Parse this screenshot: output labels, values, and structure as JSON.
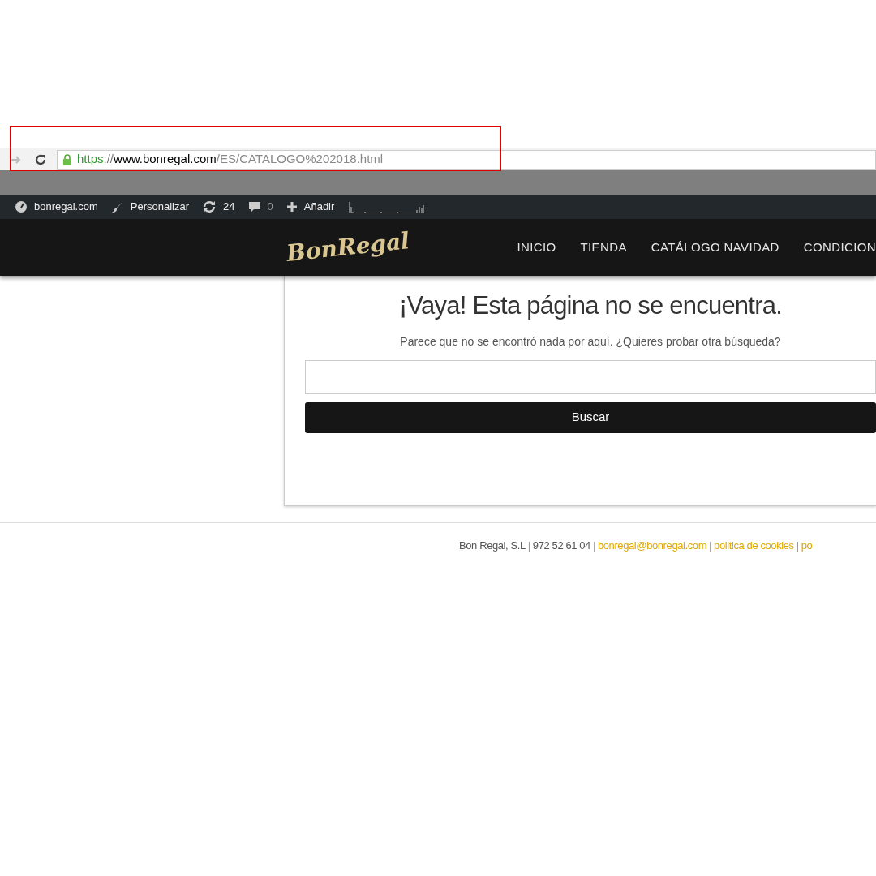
{
  "browser": {
    "url": {
      "scheme": "https",
      "separator": "://",
      "host": "www.bonregal.com",
      "path": "/ES/CATALOGO%202018.html"
    },
    "highlighted": true
  },
  "admin_bar": {
    "items": [
      {
        "kind": "site",
        "label": "bonregal.com"
      },
      {
        "kind": "customize",
        "label": "Personalizar"
      },
      {
        "kind": "updates",
        "label": "24"
      },
      {
        "kind": "comments",
        "label": "0"
      },
      {
        "kind": "add",
        "label": "Añadir"
      }
    ]
  },
  "header": {
    "logo": "BonRegal",
    "nav": [
      {
        "label": "INICIO"
      },
      {
        "label": "TIENDA"
      },
      {
        "label": "CATÁLOGO NAVIDAD"
      },
      {
        "label": "CONDICION"
      }
    ]
  },
  "not_found": {
    "title": "¡Vaya! Esta página no se encuentra.",
    "message": "Parece que no se encontró nada por aquí. ¿Quieres probar otra búsqueda?",
    "search_button": "Buscar"
  },
  "footer": {
    "parts": [
      {
        "kind": "text",
        "text": "Bon Regal, S.L"
      },
      {
        "kind": "separator",
        "text": "|"
      },
      {
        "kind": "text",
        "text": "972 52 61 04"
      },
      {
        "kind": "separator",
        "text": "|"
      },
      {
        "kind": "link",
        "text": "bonregal@bonregal.com"
      },
      {
        "kind": "separator",
        "text": "|"
      },
      {
        "kind": "link",
        "text": "politica de cookies"
      },
      {
        "kind": "separator",
        "text": "|"
      },
      {
        "kind": "link",
        "text": "po"
      }
    ]
  }
}
